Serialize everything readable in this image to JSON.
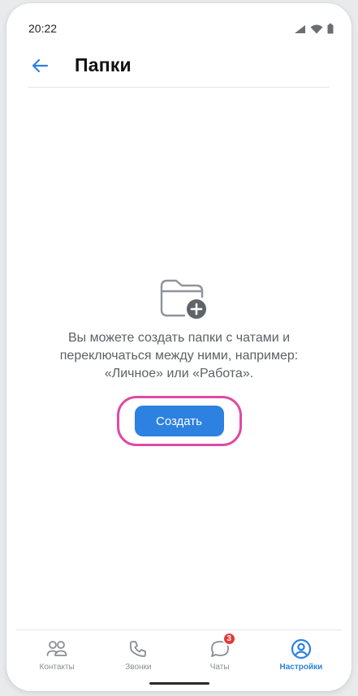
{
  "status_bar": {
    "time": "20:22",
    "icons": [
      "signal-icon",
      "wifi-icon",
      "battery-icon"
    ]
  },
  "header": {
    "title": "Папки",
    "back_icon": "arrow-left-icon"
  },
  "empty_state": {
    "icon": "folder-add-icon",
    "text": "Вы можете создать папки с чатами и переключаться между ними, например: «Личное» или «Работа».",
    "create_label": "Создать"
  },
  "bottom_nav": {
    "items": [
      {
        "label": "Контакты",
        "icon": "contacts-icon",
        "active": false
      },
      {
        "label": "Звонки",
        "icon": "phone-icon",
        "active": false
      },
      {
        "label": "Чаты",
        "icon": "chat-icon",
        "active": false,
        "badge": "3"
      },
      {
        "label": "Настройки",
        "icon": "settings-icon",
        "active": true
      }
    ]
  },
  "colors": {
    "accent": "#2d81e0",
    "highlight_outline": "#df4aa4",
    "badge": "#e33a3a",
    "text_secondary": "#5d6066",
    "nav_inactive": "#8a8d93"
  }
}
